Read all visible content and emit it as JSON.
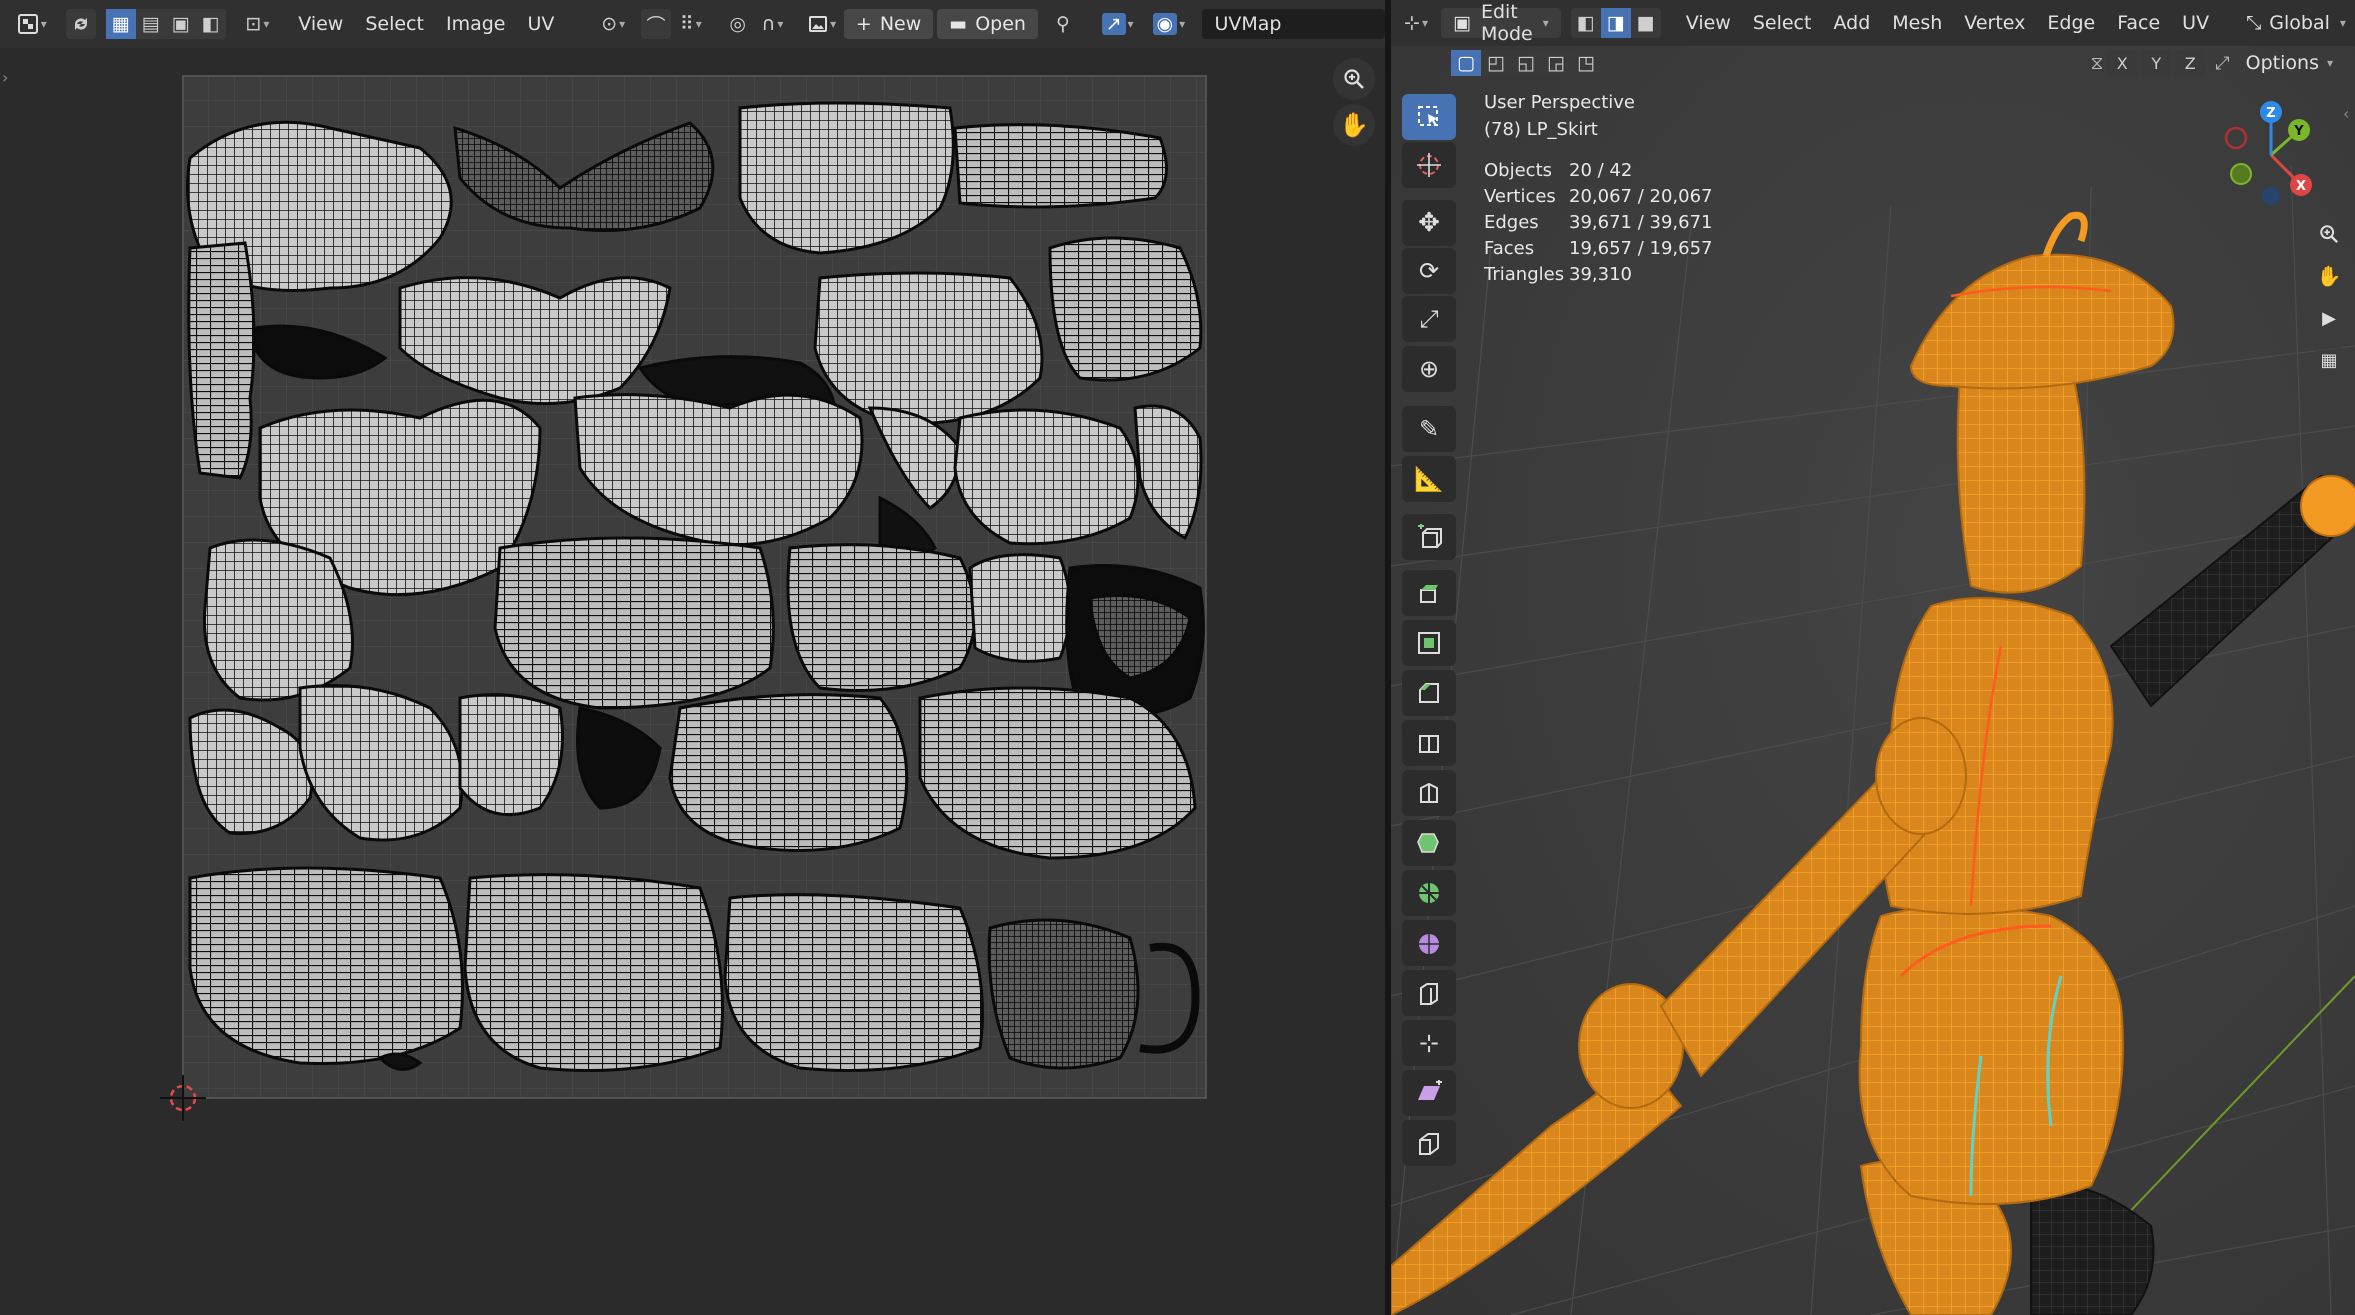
{
  "uv_editor": {
    "menus": [
      "View",
      "Select",
      "Image",
      "UV"
    ],
    "new_label": "New",
    "open_label": "Open",
    "uvmap_name": "UVMap"
  },
  "viewport": {
    "mode": "Edit Mode",
    "menus": [
      "View",
      "Select",
      "Add",
      "Mesh",
      "Vertex",
      "Edge",
      "Face",
      "UV"
    ],
    "orientation": "Global",
    "options_label": "Options",
    "axes": [
      "X",
      "Y",
      "Z"
    ],
    "overlay": {
      "view_name": "User Perspective",
      "object_name": "(78) LP_Skirt",
      "stats": [
        {
          "label": "Objects",
          "value": "20 / 42"
        },
        {
          "label": "Vertices",
          "value": "20,067 / 20,067"
        },
        {
          "label": "Edges",
          "value": "39,671 / 39,671"
        },
        {
          "label": "Faces",
          "value": "19,657 / 19,657"
        },
        {
          "label": "Triangles",
          "value": "39,310"
        }
      ]
    },
    "gizmo": {
      "x": "X",
      "y": "Y",
      "z": "Z"
    }
  },
  "colors": {
    "accent": "#4772b3",
    "selection": "#f29a22",
    "active_edge": "#ff5a1f",
    "seam": "#5fd3c8",
    "axis_x": "#e04545",
    "axis_y": "#7ab82a",
    "axis_z": "#2e8ae6"
  }
}
